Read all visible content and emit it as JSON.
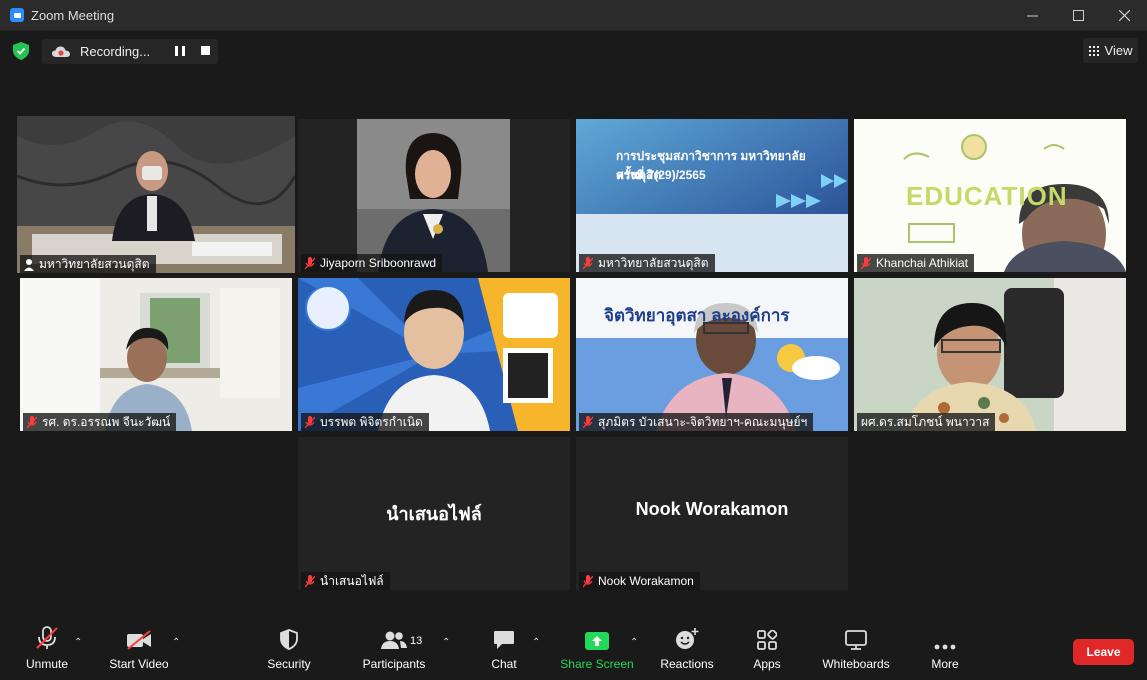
{
  "window": {
    "title": "Zoom Meeting"
  },
  "recording": {
    "label": "Recording..."
  },
  "view": {
    "label": "View"
  },
  "tiles": [
    {
      "name": "มหาวิทยาลัยสวนดุสิต",
      "bg": "#4a4a4a"
    },
    {
      "name": "Jiyaporn Sriboonrawd",
      "bg": "#2a2a2a"
    },
    {
      "name": "มหาวิทยาลัยสวนดุสิต",
      "bg": "#3b5b9a",
      "slide_title": "การประชุมสภาวิชาการ มหาวิทยาลัยสวนดุสิต",
      "slide_subtitle": "ครั้งที่ 7(29)/2565"
    },
    {
      "name": "Khanchai Athikiat",
      "bg": "#ffffff",
      "slide_text": "EDUCATION"
    },
    {
      "name": "รศ. ดร.อรรณพ จีนะวัฒน์",
      "bg": "#e8e6e0"
    },
    {
      "name": "บรรพต พิจิตรกำเนิด",
      "bg": "#2a5fb8"
    },
    {
      "name": "สุภมิตร บัวเสนาะ-จิตวิทยาฯ-คณะมนุษย์ฯ",
      "bg": "#5b8fd6",
      "slide_text": "จิตวิทยาอุตสา    ละองค์การ"
    },
    {
      "name": "ผศ.ดร.สมโภชน์ พนาวาส",
      "bg": "#d5dcd0"
    },
    {
      "name": "นำเสนอไฟล์",
      "bg": "#232323",
      "center_name": "นำเสนอไฟล์"
    },
    {
      "name": "Nook Worakamon",
      "bg": "#232323",
      "center_name": "Nook Worakamon"
    }
  ],
  "toolbar": {
    "unmute": "Unmute",
    "start_video": "Start Video",
    "security": "Security",
    "participants": "Participants",
    "participants_count": "13",
    "chat": "Chat",
    "share_screen": "Share Screen",
    "reactions": "Reactions",
    "apps": "Apps",
    "whiteboards": "Whiteboards",
    "more": "More",
    "leave": "Leave"
  },
  "colors": {
    "active_speaker": "#c8ec6e",
    "share_green": "#23d959",
    "leave_red": "#e02828"
  }
}
